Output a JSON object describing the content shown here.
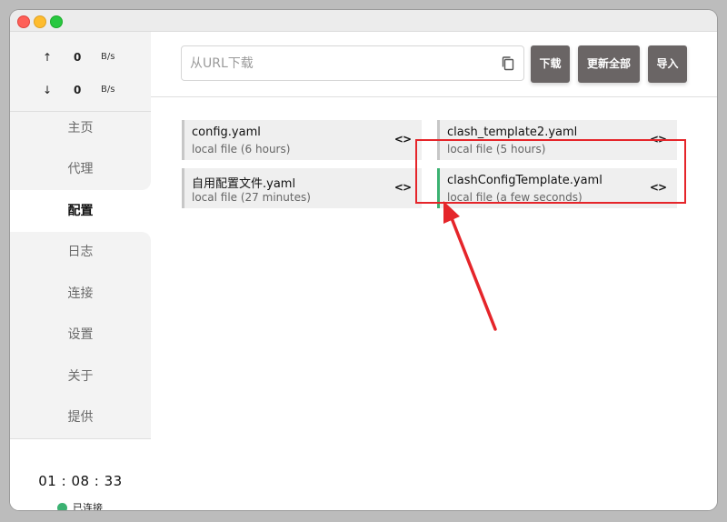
{
  "speed": {
    "up": {
      "arrow": "↑",
      "value": "0",
      "unit": "B/s"
    },
    "down": {
      "arrow": "↓",
      "value": "0",
      "unit": "B/s"
    }
  },
  "sidebar": {
    "items": [
      {
        "label": "主页"
      },
      {
        "label": "代理"
      },
      {
        "label": "配置"
      },
      {
        "label": "日志"
      },
      {
        "label": "连接"
      },
      {
        "label": "设置"
      },
      {
        "label": "关于"
      },
      {
        "label": "提供"
      }
    ],
    "active": "配置"
  },
  "status": {
    "uptime": "01 : 08 : 33",
    "connection": "已连接",
    "connection_color": "#3bb272"
  },
  "toolbar": {
    "url_placeholder": "从URL下载",
    "download_label": "下载",
    "update_all_label": "更新全部",
    "import_label": "导入"
  },
  "profiles": [
    {
      "name": "config.yaml",
      "detail": "local file (6 hours)",
      "active": false
    },
    {
      "name": "clash_template2.yaml",
      "detail": "local file (5 hours)",
      "active": false
    },
    {
      "name": "自用配置文件.yaml",
      "detail": "local file (27 minutes)",
      "active": false
    },
    {
      "name": "clashConfigTemplate.yaml",
      "detail": "local file (a few seconds)",
      "active": true
    }
  ],
  "icons": {
    "edit": "<>",
    "copy": "copy-icon"
  },
  "colors": {
    "button_bg": "#6a6565",
    "active_bar": "#3bb272",
    "annotation": "#e5252a"
  }
}
